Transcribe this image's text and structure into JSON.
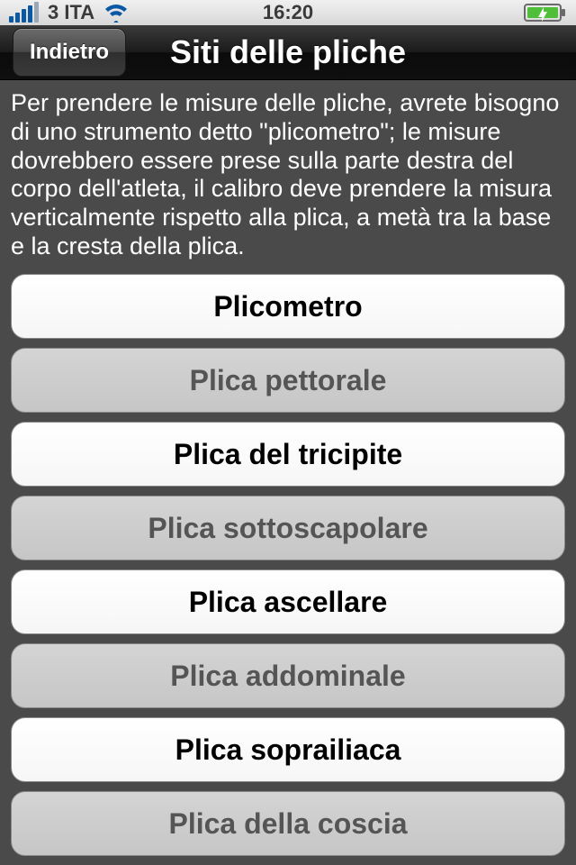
{
  "statusbar": {
    "carrier": "3 ITA",
    "time": "16:20"
  },
  "nav": {
    "back_label": "Indietro",
    "title": "Siti delle pliche"
  },
  "description": "Per prendere le misure delle pliche, avrete bisogno di uno strumento detto \"plicometro\"; le misure dovrebbero essere prese sulla parte destra del corpo dell'atleta, il calibro deve prendere la misura verticalmente rispetto alla plica, a metà tra la base e la cresta della plica.",
  "items": [
    {
      "label": "Plicometro"
    },
    {
      "label": "Plica pettorale"
    },
    {
      "label": "Plica del tricipite"
    },
    {
      "label": "Plica sottoscapolare"
    },
    {
      "label": "Plica ascellare"
    },
    {
      "label": "Plica addominale"
    },
    {
      "label": "Plica soprailiaca"
    },
    {
      "label": "Plica della coscia"
    }
  ]
}
